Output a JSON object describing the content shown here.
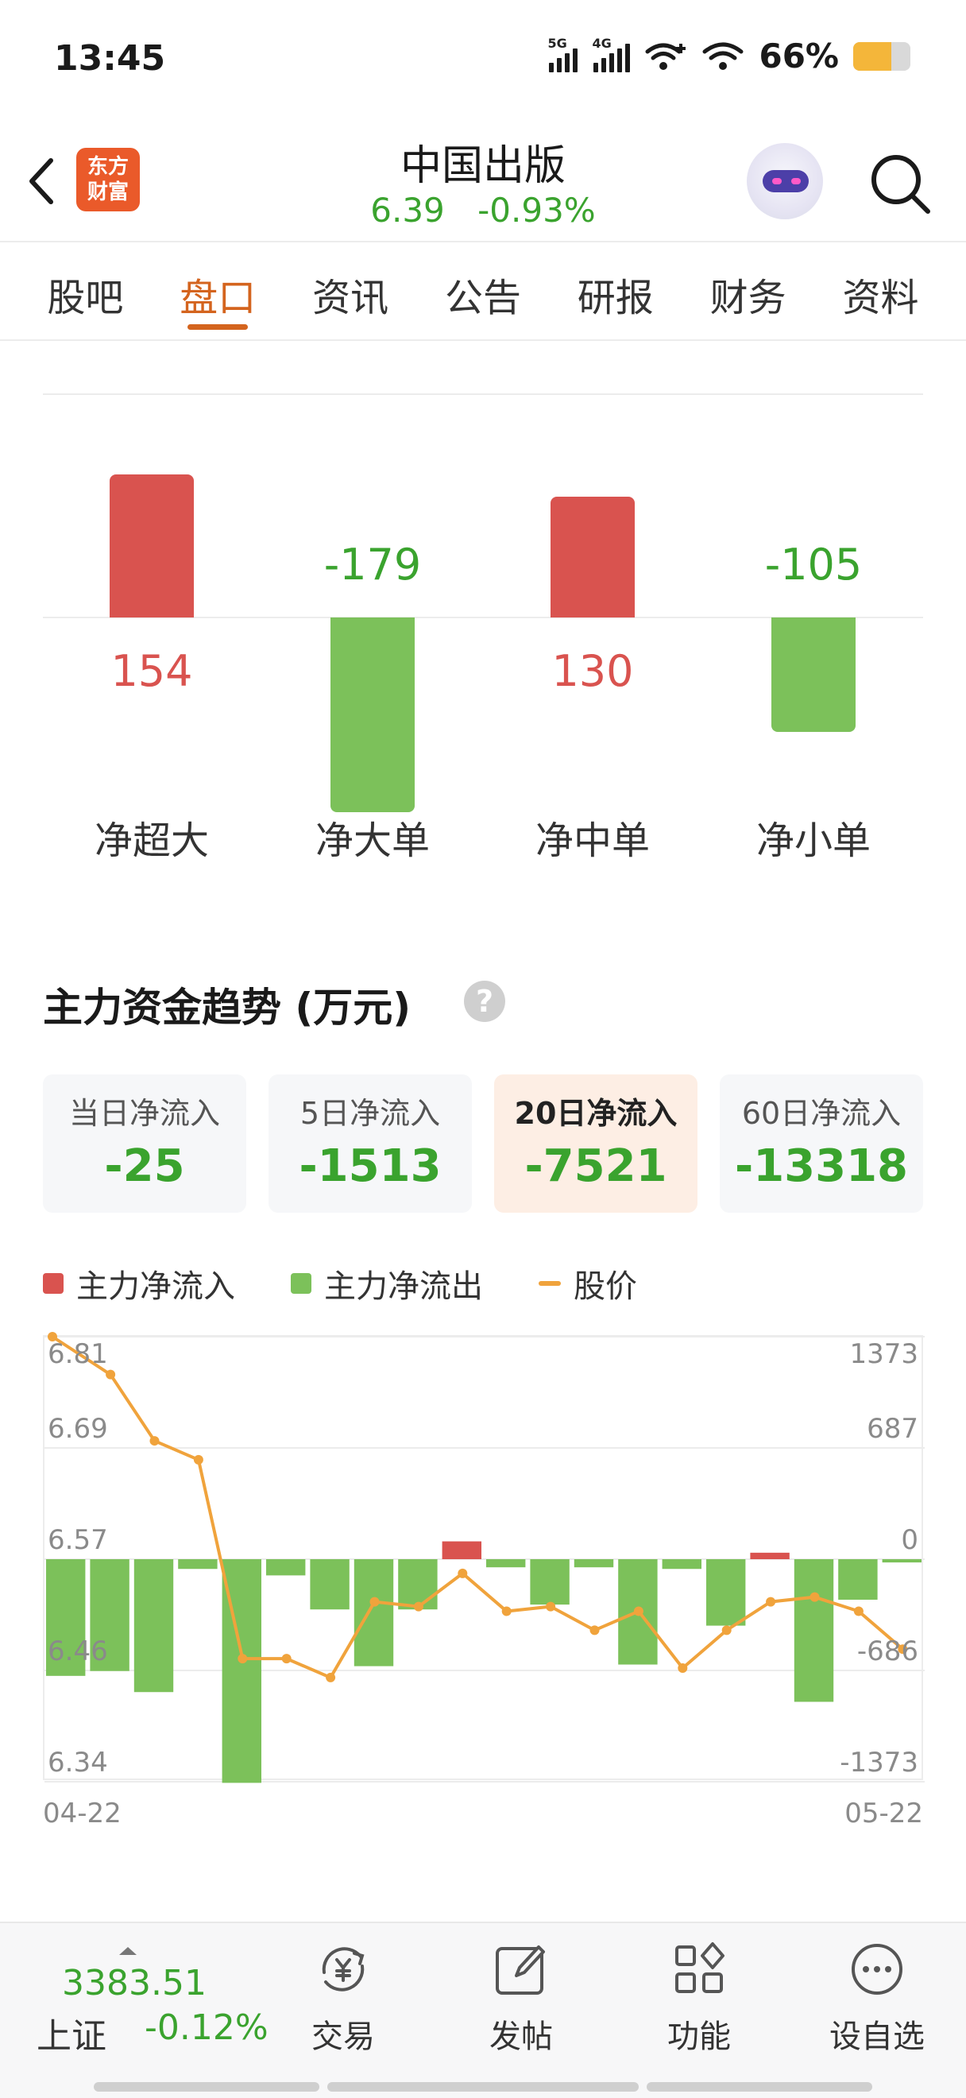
{
  "status_bar": {
    "time": "13:45",
    "sig1": "5G",
    "sig2": "4G",
    "battery": "66%",
    "battery_level": 0.66
  },
  "header": {
    "logo_line1": "东方",
    "logo_line2": "财富",
    "title": "中国出版",
    "price": "6.39",
    "change": "-0.93%"
  },
  "tabs": [
    "股吧",
    "盘口",
    "资讯",
    "公告",
    "研报",
    "财务",
    "资料"
  ],
  "active_tab": "盘口",
  "flow_summary": [
    {
      "label": "净超大",
      "value": "154"
    },
    {
      "label": "净大单",
      "value": "-179"
    },
    {
      "label": "净中单",
      "value": "130"
    },
    {
      "label": "净小单",
      "value": "-105"
    }
  ],
  "trend": {
    "title": "主力资金趋势 (万元)",
    "help": "?",
    "periods": [
      {
        "label": "当日净流入",
        "value": "-25"
      },
      {
        "label": "5日净流入",
        "value": "-1513"
      },
      {
        "label": "20日净流入",
        "value": "-7521",
        "active": true
      },
      {
        "label": "60日净流入",
        "value": "-13318"
      }
    ],
    "legend": {
      "inflow": "主力净流入",
      "outflow": "主力净流出",
      "price": "股价"
    },
    "colors": {
      "inflow": "#d9534f",
      "outflow": "#7cc15a",
      "price": "#f0a33c"
    }
  },
  "chart_data": {
    "type": "bar",
    "x_start": "04-22",
    "x_end": "05-22",
    "y_left_ticks": [
      "6.81",
      "6.69",
      "6.57",
      "6.46",
      "6.34"
    ],
    "y_right_ticks": [
      "1373",
      "687",
      "0",
      "-686",
      "-1373"
    ],
    "ylim_flow": [
      -1373,
      1373
    ],
    "ylim_price": [
      6.34,
      6.81
    ],
    "series": [
      {
        "name": "主力净流入/净流出",
        "values": [
          -720,
          -690,
          -820,
          -60,
          -1380,
          -100,
          -310,
          -660,
          -310,
          110,
          -50,
          -280,
          -50,
          -650,
          -60,
          -410,
          40,
          -880,
          -250,
          -20
        ]
      },
      {
        "name": "股价",
        "values": [
          6.81,
          6.77,
          6.7,
          6.68,
          6.47,
          6.47,
          6.45,
          6.53,
          6.525,
          6.56,
          6.52,
          6.525,
          6.5,
          6.52,
          6.46,
          6.5,
          6.53,
          6.535,
          6.52,
          6.48
        ]
      }
    ]
  },
  "bottom_bar": {
    "index_price": "3383.51",
    "index_name": "上证",
    "index_change": "-0.12%",
    "items": [
      {
        "label": "交易"
      },
      {
        "label": "发帖"
      },
      {
        "label": "功能"
      },
      {
        "label": "设自选"
      }
    ]
  }
}
